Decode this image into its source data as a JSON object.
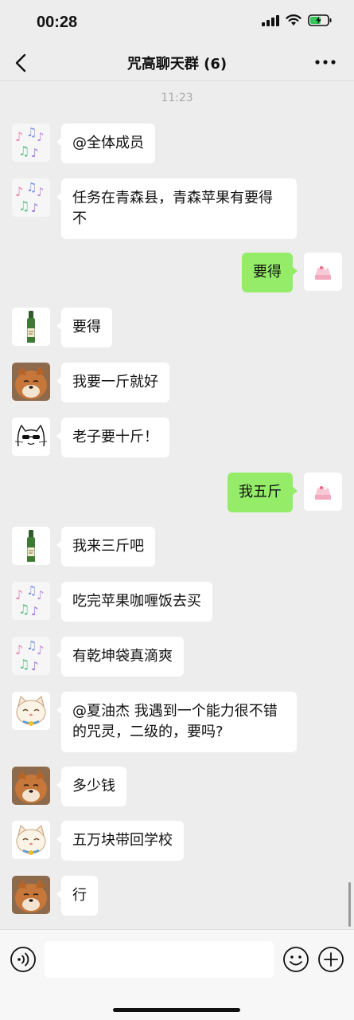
{
  "status_bar": {
    "time": "00:28"
  },
  "nav": {
    "title": "咒高聊天群 (6)"
  },
  "chat": {
    "timestamp": "11:23",
    "messages": [
      {
        "side": "left",
        "avatar": "music-notes",
        "text": "@全体成员"
      },
      {
        "side": "left",
        "avatar": "music-notes",
        "text": "任务在青森县，青森苹果有要得不"
      },
      {
        "side": "right",
        "avatar": "cake",
        "text": "要得"
      },
      {
        "side": "left",
        "avatar": "bottle",
        "text": "要得"
      },
      {
        "side": "left",
        "avatar": "fox",
        "text": "我要一斤就好"
      },
      {
        "side": "left",
        "avatar": "cat-sketch",
        "text": "老子要十斤！"
      },
      {
        "side": "right",
        "avatar": "cake",
        "text": "我五斤"
      },
      {
        "side": "left",
        "avatar": "bottle",
        "text": "我来三斤吧"
      },
      {
        "side": "left",
        "avatar": "music-notes",
        "text": "吃完苹果咖喱饭去买"
      },
      {
        "side": "left",
        "avatar": "music-notes",
        "text": "有乾坤袋真滴爽"
      },
      {
        "side": "left",
        "avatar": "lucky-cat",
        "text": "@夏油杰 我遇到一个能力很不错的咒灵，二级的，要吗?"
      },
      {
        "side": "left",
        "avatar": "fox",
        "text": "多少钱"
      },
      {
        "side": "left",
        "avatar": "lucky-cat",
        "text": "五万块带回学校"
      },
      {
        "side": "left",
        "avatar": "fox",
        "text": "行"
      }
    ]
  },
  "input": {
    "value": "",
    "placeholder": ""
  },
  "colors": {
    "background": "#ededed",
    "self_bubble": "#95ec69",
    "other_bubble": "#ffffff",
    "battery": "#34c759"
  },
  "icons": [
    "back-icon",
    "more-icon",
    "signal-icon",
    "wifi-icon",
    "battery-icon",
    "voice-icon",
    "emoji-icon",
    "plus-icon"
  ]
}
